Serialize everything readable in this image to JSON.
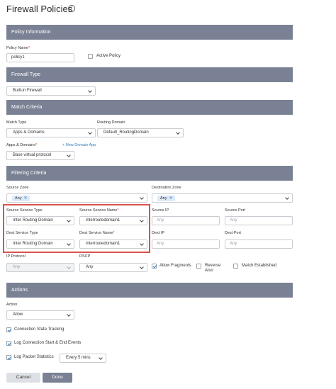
{
  "page": {
    "title": "Firewall Policies"
  },
  "sections": {
    "policy_info": "Policy Information",
    "firewall_type": "Firewall Type",
    "match_criteria": "Match Criteria",
    "filtering_criteria": "Filtering Criteria",
    "actions": "Actions"
  },
  "policy": {
    "name_label": "Policy Name",
    "name_value": "policy1",
    "active_label": "Active Policy",
    "active_checked": false
  },
  "firewall": {
    "type_value": "Built-in Firewall"
  },
  "match": {
    "match_type_label": "Match Type",
    "match_type_value": "Apps & Domains",
    "routing_domain_label": "Routing Domain",
    "routing_domain_value": "Default_RoutingDomain",
    "apps_label": "Apps & Domains",
    "new_domain_link": "+ New Domain App",
    "apps_value": "Base virtual protocol"
  },
  "filtering": {
    "source_zone_label": "Source Zone",
    "source_zone_chip": "Any",
    "dest_zone_label": "Destination Zone",
    "dest_zone_chip": "Any",
    "source_service_type_label": "Source Service Type",
    "source_service_type_value": "Inter Routing Domain",
    "source_service_name_label": "Source Service Name",
    "source_service_name_value": "interroutedomain1",
    "source_ip_label": "Source IP",
    "source_ip_placeholder": "Any",
    "source_port_label": "Source Port",
    "source_port_placeholder": "Any",
    "dest_service_type_label": "Dest Service Type",
    "dest_service_type_value": "Inter Routing Domain",
    "dest_service_name_label": "Dest Service Name",
    "dest_service_name_value": "interroutedomain1",
    "dest_ip_label": "Dest IP",
    "dest_ip_placeholder": "Any",
    "dest_port_label": "Dest Port",
    "dest_port_placeholder": "Any",
    "ip_protocol_label": "IP Protocol",
    "ip_protocol_value": "Any",
    "dscp_label": "DSCP",
    "dscp_value": "Any",
    "allow_fragments_label": "Allow Fragments",
    "reverse_also_label": "Reverse Also",
    "match_established_label": "Match Established"
  },
  "actions": {
    "action_label": "Action",
    "action_value": "Allow",
    "connection_tracking_label": "Connection State Tracking",
    "log_connection_label": "Log Connection Start & End Events",
    "log_packet_label": "Log Packet Statistics",
    "log_interval_value": "Every 5 mins"
  },
  "buttons": {
    "cancel": "Cancel",
    "done": "Done"
  },
  "colors": {
    "band": "#7a8194",
    "accent": "#2f7ec4",
    "highlight": "#d9534f"
  }
}
